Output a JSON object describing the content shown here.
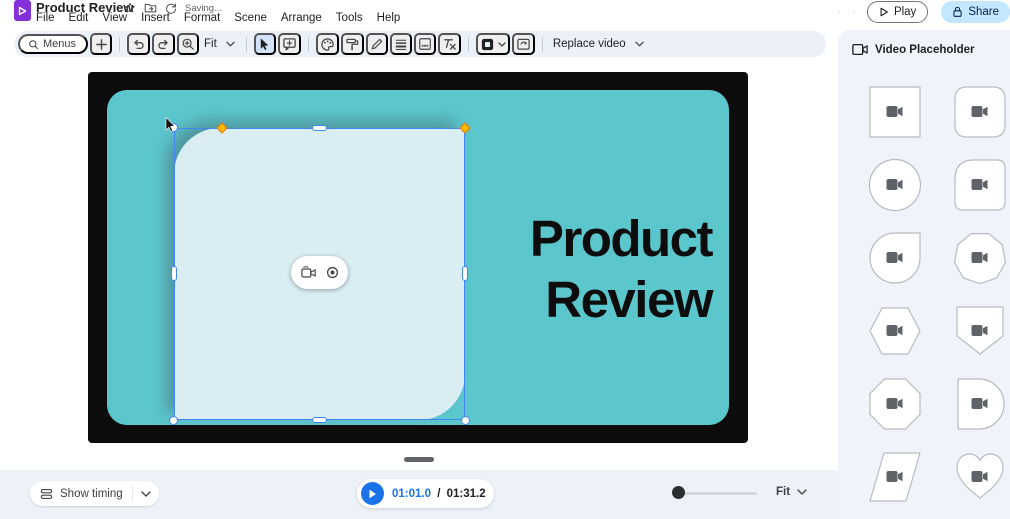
{
  "header": {
    "doc_title": "Product Review",
    "saving_label": "Saving...",
    "menu_items": [
      "File",
      "Edit",
      "View",
      "Insert",
      "Format",
      "Scene",
      "Arrange",
      "Tools",
      "Help"
    ],
    "play_button_label": "Play",
    "share_button_label": "Share"
  },
  "toolbar": {
    "menus_label": "Menus",
    "zoom_fit_label": "Fit",
    "replace_video_label": "Replace video"
  },
  "right_panel": {
    "title": "Video Placeholder",
    "shapes": [
      "square",
      "rounded-square",
      "circle",
      "rounded-corner-square",
      "teardrop",
      "nonagon",
      "hexagon",
      "banner",
      "octagon",
      "half-round",
      "parallelogram",
      "heart"
    ]
  },
  "slide": {
    "title_line1": "Product",
    "title_line2": "Review",
    "background_color": "#5cc6cd",
    "placeholder_fill": "#d9edf3",
    "selection_color": "#4285f4",
    "adjust_handle_color": "#fbbc04"
  },
  "bottom_bar": {
    "show_timing_label": "Show timing",
    "current_time": "01:01.0",
    "separator": "/",
    "total_time": "01:31.2",
    "zoom_fit_label": "Fit"
  },
  "colors": {
    "toolbar_bg": "#ecf1f9",
    "panel_bg": "#f0f4fa",
    "bottom_bar_bg": "#edf2f8",
    "accent_blue": "#1a73e8",
    "share_bg": "#c2e7ff",
    "logo_purple": "#8430d8"
  }
}
